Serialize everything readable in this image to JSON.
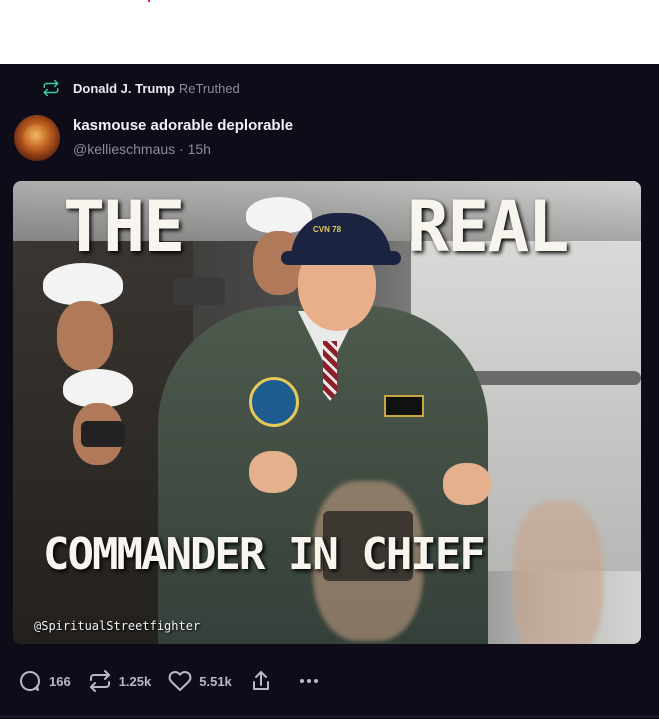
{
  "retruth": {
    "name": "Donald J. Trump",
    "label": "ReTruthed"
  },
  "author": {
    "display_name": "kasmouse adorable deplorable",
    "handle": "@kellieschmaus",
    "separator": "·",
    "time": "15h"
  },
  "media": {
    "headline_left": "THE",
    "headline_right": "REAL",
    "bottom_caption": "COMMANDER IN CHIEF",
    "watermark": "@SpiritualStreetfighter",
    "cap_text": "CVN 78"
  },
  "actions": {
    "replies": "166",
    "retruths": "1.25k",
    "likes": "5.51k"
  },
  "colors": {
    "background": "#0d0c18",
    "accent_retruth": "#3ec9a1",
    "muted_text": "#8b8a99"
  },
  "icons": [
    "retruth-icon",
    "reply-icon",
    "retruth-icon",
    "heart-icon",
    "share-icon",
    "more-icon"
  ]
}
